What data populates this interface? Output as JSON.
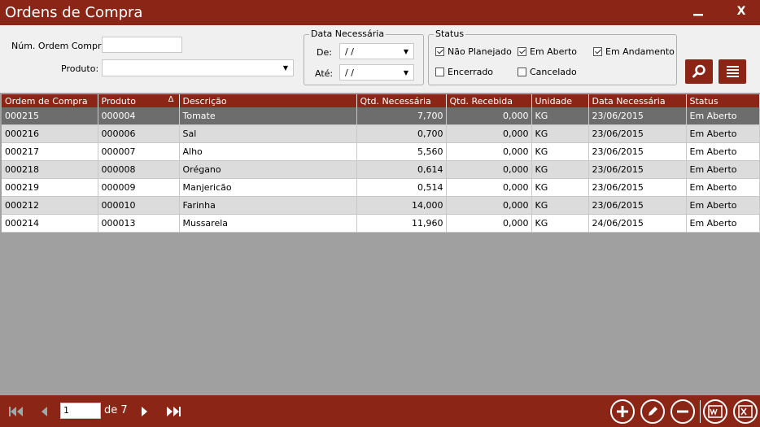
{
  "window": {
    "title": "Ordens de Compra",
    "minimize": "—",
    "close": "X"
  },
  "filters": {
    "ordem_label": "Núm. Ordem Compra:",
    "ordem_value": "",
    "produto_label": "Produto:",
    "produto_value": "",
    "data_group": "Data Necessária",
    "de_label": "De:",
    "de_value": "/ /",
    "ate_label": "Até:",
    "ate_value": "/ /",
    "status_group": "Status",
    "status": [
      {
        "label": "Não Planejado",
        "checked": true
      },
      {
        "label": "Em Aberto",
        "checked": true
      },
      {
        "label": "Em Andamento",
        "checked": true
      },
      {
        "label": "Encerrado",
        "checked": false
      },
      {
        "label": "Cancelado",
        "checked": false
      }
    ]
  },
  "icons": {
    "search": "search-icon",
    "list": "list-icon",
    "first": "first-page-icon",
    "prev": "prev-page-icon",
    "next": "next-page-icon",
    "last": "last-page-icon",
    "add": "add-icon",
    "edit": "edit-icon",
    "remove": "remove-icon",
    "word": "word-export-icon",
    "excel": "excel-export-icon"
  },
  "colors": {
    "brand": "#8b2617",
    "selected_row": "#6d6d6d",
    "alt_row": "#dcdcdc"
  },
  "table": {
    "columns": [
      "Ordem de Compra",
      "Produto",
      "Descrição",
      "Qtd. Necessária",
      "Qtd. Recebida",
      "Unidade",
      "Data Necessária",
      "Status"
    ],
    "sort_indicator": "Δ",
    "rows": [
      [
        "000215",
        "000004",
        "Tomate",
        "7,700",
        "0,000",
        "KG",
        "23/06/2015",
        "Em Aberto"
      ],
      [
        "000216",
        "000006",
        "Sal",
        "0,700",
        "0,000",
        "KG",
        "23/06/2015",
        "Em Aberto"
      ],
      [
        "000217",
        "000007",
        "Alho",
        "5,560",
        "0,000",
        "KG",
        "23/06/2015",
        "Em Aberto"
      ],
      [
        "000218",
        "000008",
        "Orégano",
        "0,614",
        "0,000",
        "KG",
        "23/06/2015",
        "Em Aberto"
      ],
      [
        "000219",
        "000009",
        "Manjericão",
        "0,514",
        "0,000",
        "KG",
        "23/06/2015",
        "Em Aberto"
      ],
      [
        "000212",
        "000010",
        "Farinha",
        "14,000",
        "0,000",
        "KG",
        "23/06/2015",
        "Em Aberto"
      ],
      [
        "000214",
        "000013",
        "Mussarela",
        "11,960",
        "0,000",
        "KG",
        "24/06/2015",
        "Em Aberto"
      ]
    ]
  },
  "pagination": {
    "current": "1",
    "of_label": "de 7"
  }
}
